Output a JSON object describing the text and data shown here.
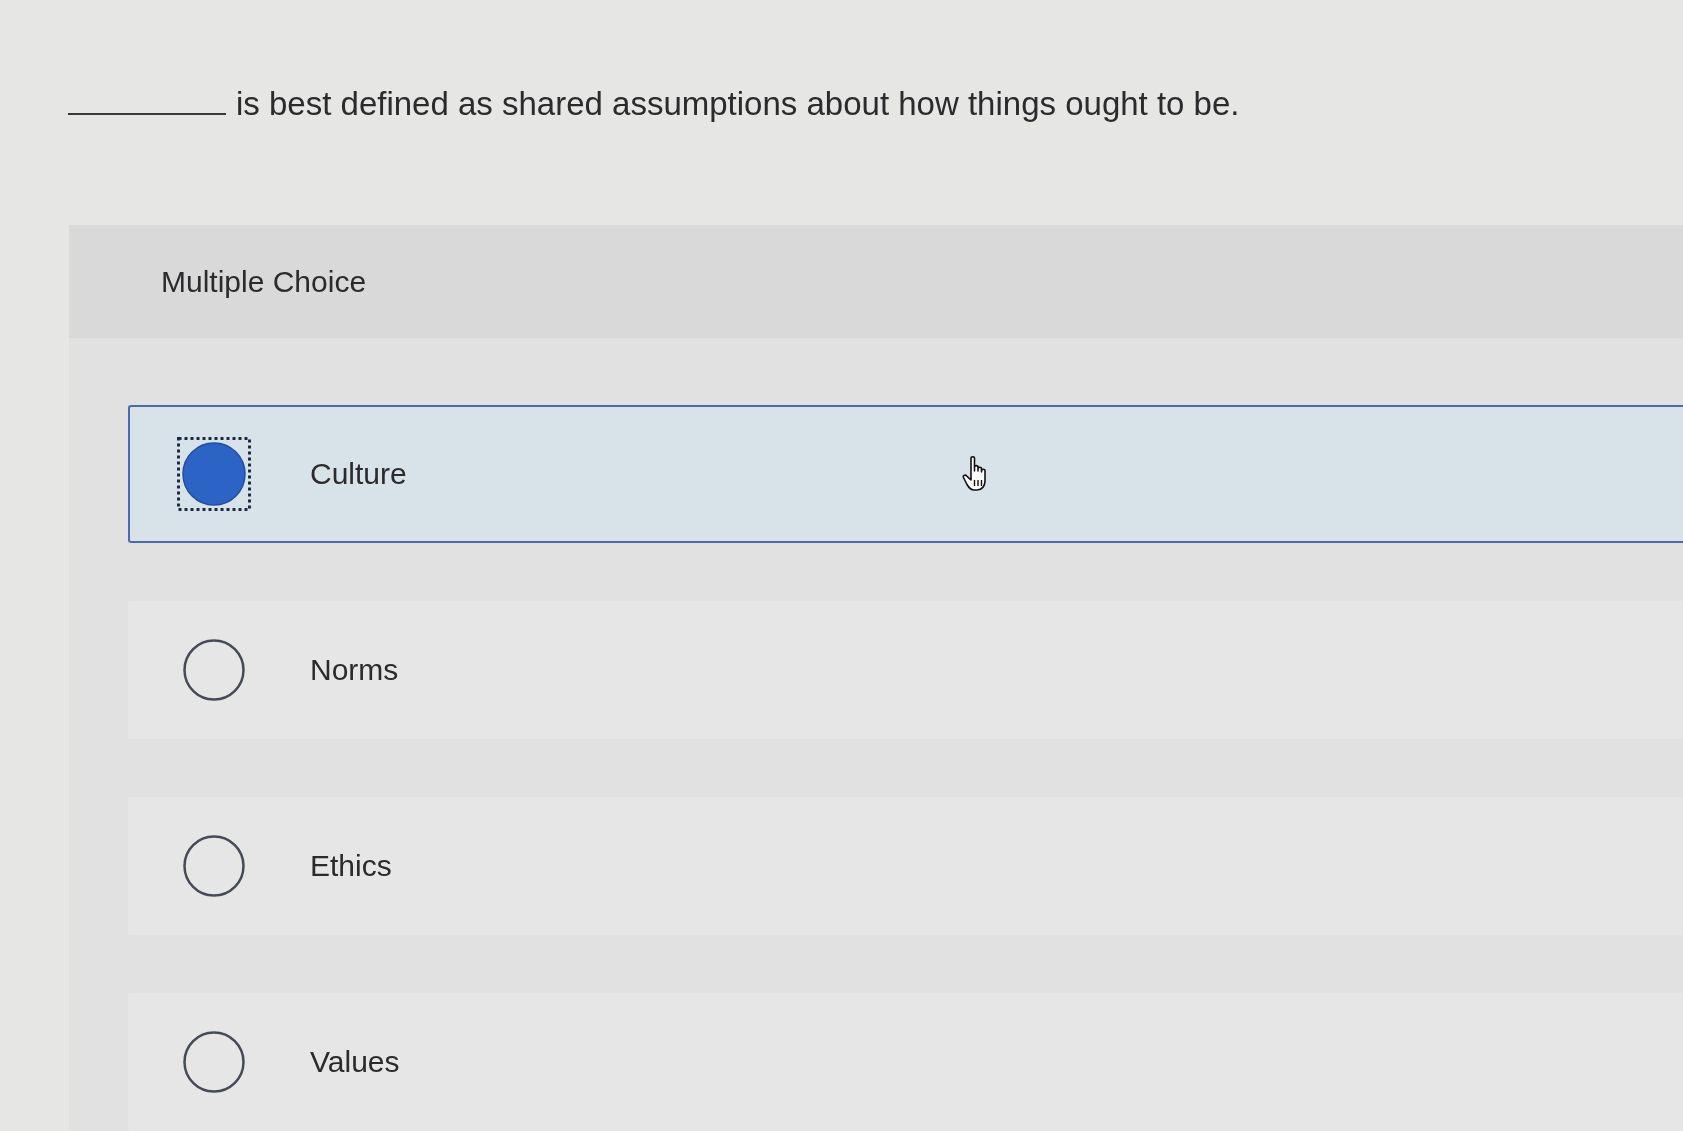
{
  "question": {
    "text": "is best defined as shared assumptions about how things ought to be."
  },
  "answer_panel": {
    "heading": "Multiple Choice",
    "options": [
      {
        "label": "Culture",
        "selected": true
      },
      {
        "label": "Norms",
        "selected": false
      },
      {
        "label": "Ethics",
        "selected": false
      },
      {
        "label": "Values",
        "selected": false
      }
    ]
  }
}
